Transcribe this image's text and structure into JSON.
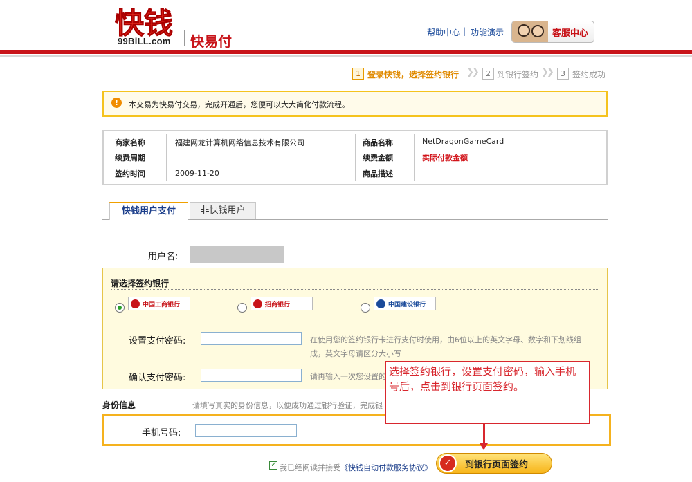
{
  "header": {
    "logo_mark": "快钱",
    "logo_domain": "99BiLL.com",
    "product_name": "快易付",
    "help_link": "帮助中心",
    "demo_link": "功能演示",
    "divider": "|",
    "service_button": "客服中心"
  },
  "steps": [
    {
      "num": "1",
      "label": "登录快钱，选择签约银行",
      "active": true
    },
    {
      "num": "2",
      "label": "到银行签约",
      "active": false
    },
    {
      "num": "3",
      "label": "签约成功",
      "active": false
    }
  ],
  "notice": {
    "icon": "!",
    "text": "本交易为快易付交易，完成开通后，您便可以大大简化付款流程。"
  },
  "info": {
    "merchant_label": "商家名称",
    "merchant_value": "福建网龙计算机网络信息技术有限公司",
    "product_label": "商品名称",
    "product_value": "NetDragonGameCard",
    "period_label": "续费周期",
    "period_value": "",
    "amount_label": "续费金额",
    "amount_value": "实际付款金额",
    "date_label": "签约时间",
    "date_value": "2009-11-20",
    "desc_label": "商品描述",
    "desc_value": ""
  },
  "tabs": [
    {
      "label": "快钱用户支付",
      "active": true
    },
    {
      "label": "非快钱用户",
      "active": false
    }
  ],
  "form": {
    "username_label": "用户名:",
    "bank_section_title": "请选择签约银行",
    "banks": [
      {
        "name": "中国工商银行",
        "selected": true,
        "color": "#c8141a"
      },
      {
        "name": "招商银行",
        "selected": false,
        "color": "#c8141a"
      },
      {
        "name": "中国建设银行",
        "selected": false,
        "color": "#1a4a9a"
      }
    ],
    "pay_password_label": "设置支付密码:",
    "pay_password_hint_line1": "在使用您的签约银行卡进行支付时使用，由6位以上的英文字母、数字和下划线组",
    "pay_password_hint_line2": "成，英文字母请区分大小写",
    "confirm_password_label": "确认支付密码:",
    "confirm_password_hint": "请再输入一次您设置的",
    "id_section_title": "身份信息",
    "id_section_hint": "请填写真实的身份信息，以便成功通过银行验证，完成银",
    "phone_label": "手机号码:"
  },
  "callout": {
    "text": "选择签约银行，设置支付密码，输入手机号后，点击到银行页面签约。"
  },
  "footer": {
    "agree_text": "我已经阅读并接受",
    "agree_link": "《快钱自动付款服务协议》",
    "submit_label": "到银行页面签约"
  },
  "colors": {
    "brand_red": "#c8141a",
    "accent_orange": "#f5b21e",
    "link_blue": "#1a4a9a"
  }
}
